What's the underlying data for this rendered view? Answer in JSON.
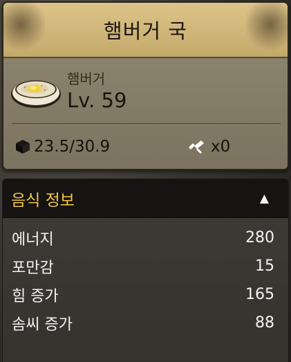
{
  "card": {
    "title": "햄버거 국",
    "item_name": "햄버거",
    "level": "Lv. 59",
    "weight": "23.5/30.9",
    "craft_count": "x0",
    "icons": {
      "food": "soup-bowl-icon",
      "weight": "cube-icon",
      "craft": "hammer-icon"
    }
  },
  "info_panel": {
    "title": "음식 정보",
    "toggle": "▲",
    "stats": [
      {
        "label": "에너지",
        "value": "280"
      },
      {
        "label": "포만감",
        "value": "15"
      },
      {
        "label": "힘 증가",
        "value": "165"
      },
      {
        "label": "솜씨 증가",
        "value": "88"
      }
    ]
  },
  "colors": {
    "title_bar": "#cfb478",
    "card_body": "#7e7662",
    "panel_header_text": "#f0c64a",
    "stat_text": "#f3f3f3"
  }
}
